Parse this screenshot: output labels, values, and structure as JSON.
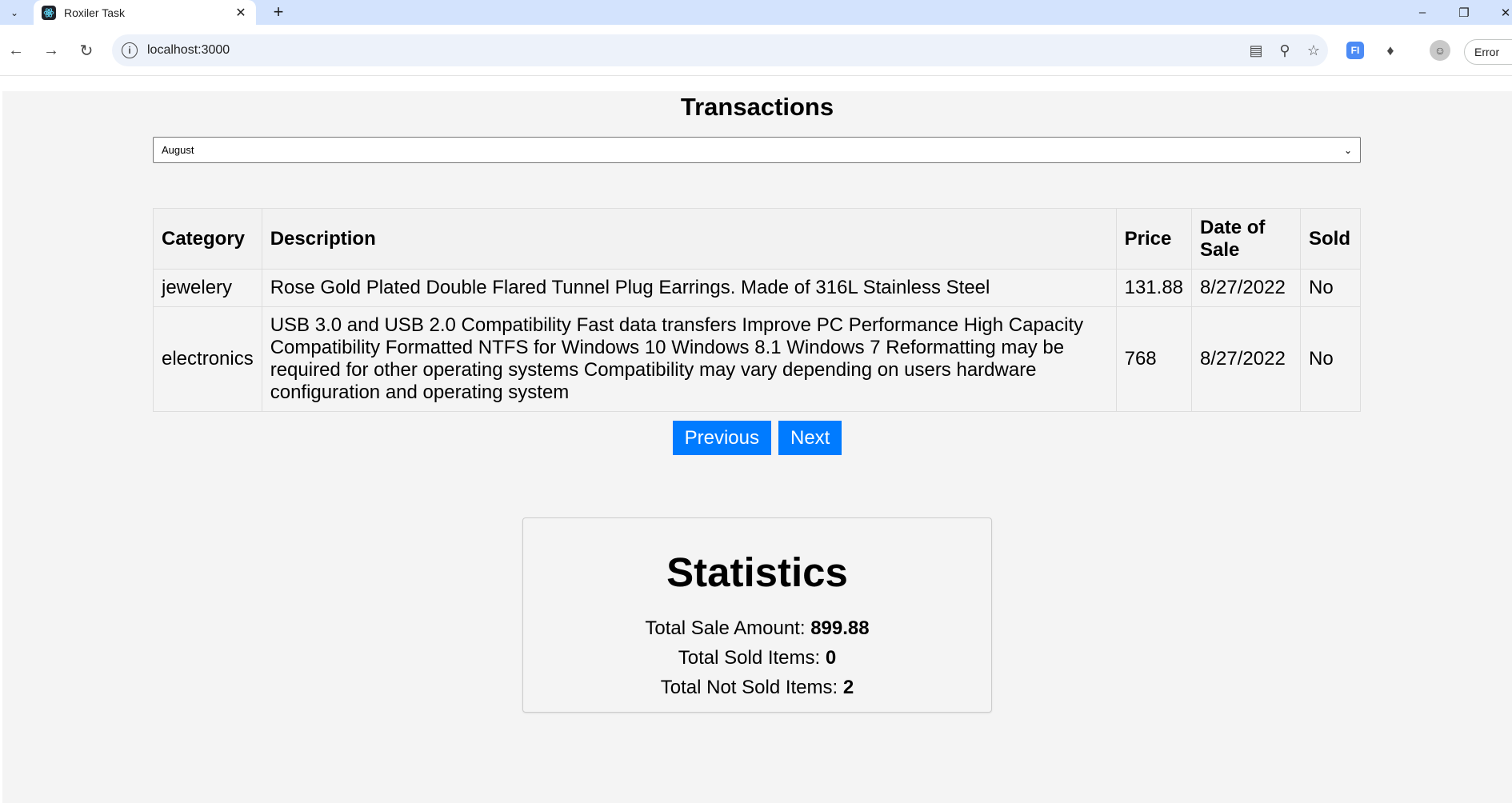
{
  "browser": {
    "tab_title": "Roxiler Task",
    "url": "localhost:3000",
    "profile_status": "Error"
  },
  "page": {
    "title": "Transactions",
    "month_select": {
      "selected": "August"
    },
    "table": {
      "headers": [
        "Category",
        "Description",
        "Price",
        "Date of Sale",
        "Sold"
      ],
      "rows": [
        {
          "category": "jewelery",
          "description": "Rose Gold Plated Double Flared Tunnel Plug Earrings. Made of 316L Stainless Steel",
          "price": "131.88",
          "date": "8/27/2022",
          "sold": "No"
        },
        {
          "category": "electronics",
          "description": "USB 3.0 and USB 2.0 Compatibility Fast data transfers Improve PC Performance High Capacity Compatibility Formatted NTFS for Windows 10 Windows 8.1 Windows 7 Reformatting may be required for other operating systems Compatibility may vary depending on users hardware configuration and operating system",
          "price": "768",
          "date": "8/27/2022",
          "sold": "No"
        }
      ]
    },
    "pagination": {
      "previous": "Previous",
      "next": "Next"
    },
    "statistics": {
      "title": "Statistics",
      "total_sale_label": "Total Sale Amount: ",
      "total_sale_value": "899.88",
      "sold_label": "Total Sold Items: ",
      "sold_value": "0",
      "not_sold_label": "Total Not Sold Items: ",
      "not_sold_value": "2"
    }
  },
  "colors": {
    "accent": "#007bff",
    "page_bg": "#f4f4f4",
    "tabstrip": "#d3e3fd"
  }
}
